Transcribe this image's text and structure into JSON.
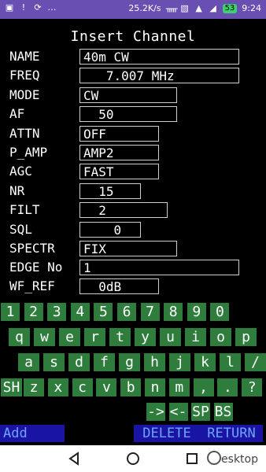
{
  "status": {
    "left_icons": [
      "image-icon",
      "alert-icon",
      "sync-icon",
      "more-icon"
    ],
    "speed": "25.2K/s",
    "battery": "53",
    "time": "9:24"
  },
  "screen_title": "Insert Channel",
  "fields": [
    {
      "label": "NAME",
      "value": "40m CW"
    },
    {
      "label": "FREQ",
      "value": "   7.007 MHz"
    },
    {
      "label": "MODE",
      "value": "CW"
    },
    {
      "label": "AF",
      "value": "  50"
    },
    {
      "label": "ATTN",
      "value": "OFF"
    },
    {
      "label": "P_AMP",
      "value": "AMP2"
    },
    {
      "label": "AGC",
      "value": "FAST"
    },
    {
      "label": "NR",
      "value": "  15"
    },
    {
      "label": "FILT",
      "value": "  2"
    },
    {
      "label": "SQL",
      "value": "    0"
    },
    {
      "label": "SPECTR",
      "value": "FIX"
    },
    {
      "label": "EDGE No",
      "value": "1"
    },
    {
      "label": "WF_REF",
      "value": "  0dB"
    }
  ],
  "keyboard": {
    "row1": [
      "1",
      "2",
      "3",
      "4",
      "5",
      "6",
      "7",
      "8",
      "9",
      "0"
    ],
    "row2": [
      "q",
      "w",
      "e",
      "r",
      "t",
      "y",
      "u",
      "i",
      "o",
      "p"
    ],
    "row3": [
      "a",
      "s",
      "d",
      "f",
      "g",
      "h",
      "j",
      "k",
      "l",
      "/"
    ],
    "row4": [
      "SH",
      "z",
      "x",
      "c",
      "v",
      "b",
      "n",
      "m",
      ",",
      ".",
      "?"
    ],
    "row5": [
      "->",
      "<-",
      "SP",
      "BS"
    ]
  },
  "bottom": {
    "add": "Add",
    "delete": "DELETE",
    "return": "RETURN"
  },
  "watermark": "esktop",
  "colors": {
    "status_bar": "#6a4fb3",
    "key_bg": "#2f7d3c",
    "bottom_bar": "#1a14a5",
    "bottom_text": "#6fa3ff"
  }
}
